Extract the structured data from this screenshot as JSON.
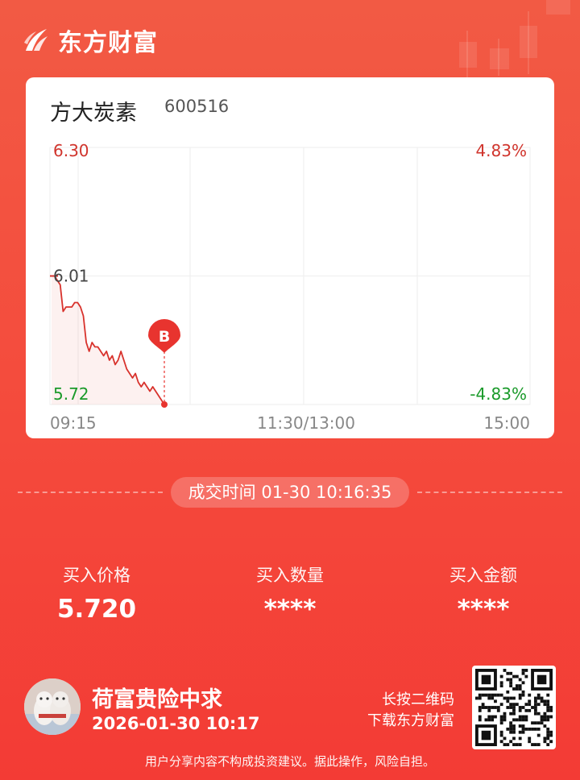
{
  "brand": {
    "name": "东方财富"
  },
  "stock": {
    "name": "方大炭素",
    "code": "600516"
  },
  "chart_data": {
    "type": "line",
    "y_left_ticks": [
      "6.30",
      "6.01",
      "5.72"
    ],
    "y_right_ticks": [
      "4.83%",
      "",
      "-4.83%"
    ],
    "x_ticks": [
      "09:15",
      "11:30/13:00",
      "15:00"
    ],
    "ylim": [
      5.72,
      6.3
    ],
    "prev_close": 6.01,
    "series": [
      {
        "values": [
          6.01,
          6.01,
          6.0,
          5.99,
          5.93,
          5.94,
          5.94,
          5.94,
          5.95,
          5.95,
          5.94,
          5.92,
          5.86,
          5.84,
          5.86,
          5.85,
          5.85,
          5.84,
          5.83,
          5.84,
          5.82,
          5.83,
          5.81,
          5.82,
          5.84,
          5.82,
          5.8,
          5.79,
          5.78,
          5.79,
          5.77,
          5.76,
          5.77,
          5.76,
          5.75,
          5.76,
          5.75,
          5.74,
          5.73,
          5.72
        ]
      }
    ],
    "marker": {
      "label": "B",
      "price": 5.72,
      "color": "#e8342f"
    },
    "colors": {
      "line": "#d8322c",
      "up": "#d0342c",
      "down": "#1a9a2a",
      "grid": "#eeeeee"
    }
  },
  "trade": {
    "time_label": "成交时间 01-30 10:16:35",
    "price_label": "买入价格",
    "price_value": "5.720",
    "qty_label": "买入数量",
    "qty_value": "****",
    "amount_label": "买入金额",
    "amount_value": "****"
  },
  "user": {
    "name": "荷富贵险中求",
    "time": "2026-01-30 10:17"
  },
  "qr_hint": {
    "line1": "长按二维码",
    "line2": "下载东方财富"
  },
  "disclaimer": "用户分享内容不构成投资建议。据此操作，风险自担。"
}
